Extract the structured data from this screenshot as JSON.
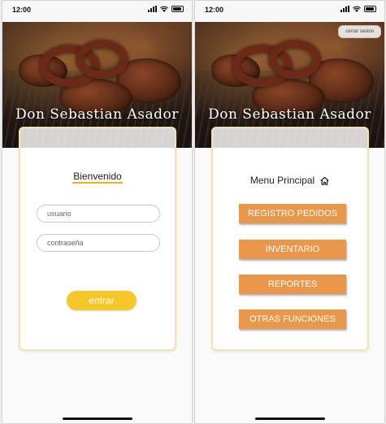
{
  "status_bar": {
    "time": "12:00"
  },
  "brand": {
    "title": "Don Sebastian Asador"
  },
  "login": {
    "heading": "Bienvenido",
    "username_placeholder": "usuario",
    "password_placeholder": "contraseña",
    "submit_label": "entrar"
  },
  "menu": {
    "logout_label": "cerrar sesion",
    "heading": "Menu Principal",
    "home_icon": "home-icon",
    "items": [
      {
        "label": "REGISTRO PEDIDOS"
      },
      {
        "label": "INVENTARIO"
      },
      {
        "label": "REPORTES"
      },
      {
        "label": "OTRAS FUNCIONES"
      }
    ]
  },
  "colors": {
    "accent_yellow": "#f5c72a",
    "menu_orange": "#e9974a",
    "card_border": "#f3e3b0"
  }
}
